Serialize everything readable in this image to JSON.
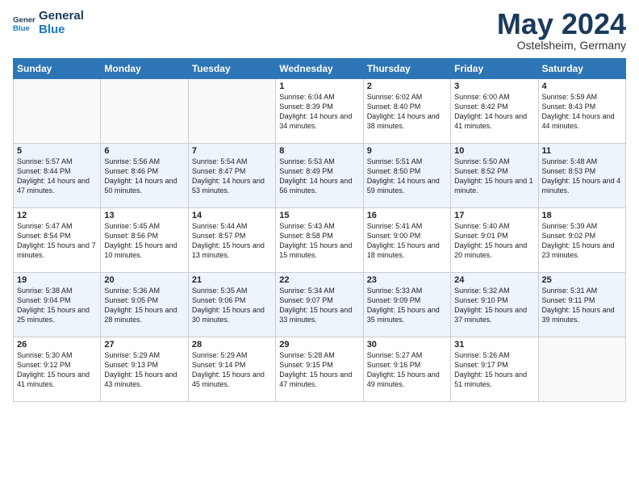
{
  "header": {
    "logo_general": "General",
    "logo_blue": "Blue",
    "month": "May 2024",
    "location": "Ostelsheim, Germany"
  },
  "weekdays": [
    "Sunday",
    "Monday",
    "Tuesday",
    "Wednesday",
    "Thursday",
    "Friday",
    "Saturday"
  ],
  "weeks": [
    [
      {
        "day": "",
        "sunrise": "",
        "sunset": "",
        "daylight": ""
      },
      {
        "day": "",
        "sunrise": "",
        "sunset": "",
        "daylight": ""
      },
      {
        "day": "",
        "sunrise": "",
        "sunset": "",
        "daylight": ""
      },
      {
        "day": "1",
        "sunrise": "Sunrise: 6:04 AM",
        "sunset": "Sunset: 8:39 PM",
        "daylight": "Daylight: 14 hours and 34 minutes."
      },
      {
        "day": "2",
        "sunrise": "Sunrise: 6:02 AM",
        "sunset": "Sunset: 8:40 PM",
        "daylight": "Daylight: 14 hours and 38 minutes."
      },
      {
        "day": "3",
        "sunrise": "Sunrise: 6:00 AM",
        "sunset": "Sunset: 8:42 PM",
        "daylight": "Daylight: 14 hours and 41 minutes."
      },
      {
        "day": "4",
        "sunrise": "Sunrise: 5:59 AM",
        "sunset": "Sunset: 8:43 PM",
        "daylight": "Daylight: 14 hours and 44 minutes."
      }
    ],
    [
      {
        "day": "5",
        "sunrise": "Sunrise: 5:57 AM",
        "sunset": "Sunset: 8:44 PM",
        "daylight": "Daylight: 14 hours and 47 minutes."
      },
      {
        "day": "6",
        "sunrise": "Sunrise: 5:56 AM",
        "sunset": "Sunset: 8:46 PM",
        "daylight": "Daylight: 14 hours and 50 minutes."
      },
      {
        "day": "7",
        "sunrise": "Sunrise: 5:54 AM",
        "sunset": "Sunset: 8:47 PM",
        "daylight": "Daylight: 14 hours and 53 minutes."
      },
      {
        "day": "8",
        "sunrise": "Sunrise: 5:53 AM",
        "sunset": "Sunset: 8:49 PM",
        "daylight": "Daylight: 14 hours and 56 minutes."
      },
      {
        "day": "9",
        "sunrise": "Sunrise: 5:51 AM",
        "sunset": "Sunset: 8:50 PM",
        "daylight": "Daylight: 14 hours and 59 minutes."
      },
      {
        "day": "10",
        "sunrise": "Sunrise: 5:50 AM",
        "sunset": "Sunset: 8:52 PM",
        "daylight": "Daylight: 15 hours and 1 minute."
      },
      {
        "day": "11",
        "sunrise": "Sunrise: 5:48 AM",
        "sunset": "Sunset: 8:53 PM",
        "daylight": "Daylight: 15 hours and 4 minutes."
      }
    ],
    [
      {
        "day": "12",
        "sunrise": "Sunrise: 5:47 AM",
        "sunset": "Sunset: 8:54 PM",
        "daylight": "Daylight: 15 hours and 7 minutes."
      },
      {
        "day": "13",
        "sunrise": "Sunrise: 5:45 AM",
        "sunset": "Sunset: 8:56 PM",
        "daylight": "Daylight: 15 hours and 10 minutes."
      },
      {
        "day": "14",
        "sunrise": "Sunrise: 5:44 AM",
        "sunset": "Sunset: 8:57 PM",
        "daylight": "Daylight: 15 hours and 13 minutes."
      },
      {
        "day": "15",
        "sunrise": "Sunrise: 5:43 AM",
        "sunset": "Sunset: 8:58 PM",
        "daylight": "Daylight: 15 hours and 15 minutes."
      },
      {
        "day": "16",
        "sunrise": "Sunrise: 5:41 AM",
        "sunset": "Sunset: 9:00 PM",
        "daylight": "Daylight: 15 hours and 18 minutes."
      },
      {
        "day": "17",
        "sunrise": "Sunrise: 5:40 AM",
        "sunset": "Sunset: 9:01 PM",
        "daylight": "Daylight: 15 hours and 20 minutes."
      },
      {
        "day": "18",
        "sunrise": "Sunrise: 5:39 AM",
        "sunset": "Sunset: 9:02 PM",
        "daylight": "Daylight: 15 hours and 23 minutes."
      }
    ],
    [
      {
        "day": "19",
        "sunrise": "Sunrise: 5:38 AM",
        "sunset": "Sunset: 9:04 PM",
        "daylight": "Daylight: 15 hours and 25 minutes."
      },
      {
        "day": "20",
        "sunrise": "Sunrise: 5:36 AM",
        "sunset": "Sunset: 9:05 PM",
        "daylight": "Daylight: 15 hours and 28 minutes."
      },
      {
        "day": "21",
        "sunrise": "Sunrise: 5:35 AM",
        "sunset": "Sunset: 9:06 PM",
        "daylight": "Daylight: 15 hours and 30 minutes."
      },
      {
        "day": "22",
        "sunrise": "Sunrise: 5:34 AM",
        "sunset": "Sunset: 9:07 PM",
        "daylight": "Daylight: 15 hours and 33 minutes."
      },
      {
        "day": "23",
        "sunrise": "Sunrise: 5:33 AM",
        "sunset": "Sunset: 9:09 PM",
        "daylight": "Daylight: 15 hours and 35 minutes."
      },
      {
        "day": "24",
        "sunrise": "Sunrise: 5:32 AM",
        "sunset": "Sunset: 9:10 PM",
        "daylight": "Daylight: 15 hours and 37 minutes."
      },
      {
        "day": "25",
        "sunrise": "Sunrise: 5:31 AM",
        "sunset": "Sunset: 9:11 PM",
        "daylight": "Daylight: 15 hours and 39 minutes."
      }
    ],
    [
      {
        "day": "26",
        "sunrise": "Sunrise: 5:30 AM",
        "sunset": "Sunset: 9:12 PM",
        "daylight": "Daylight: 15 hours and 41 minutes."
      },
      {
        "day": "27",
        "sunrise": "Sunrise: 5:29 AM",
        "sunset": "Sunset: 9:13 PM",
        "daylight": "Daylight: 15 hours and 43 minutes."
      },
      {
        "day": "28",
        "sunrise": "Sunrise: 5:29 AM",
        "sunset": "Sunset: 9:14 PM",
        "daylight": "Daylight: 15 hours and 45 minutes."
      },
      {
        "day": "29",
        "sunrise": "Sunrise: 5:28 AM",
        "sunset": "Sunset: 9:15 PM",
        "daylight": "Daylight: 15 hours and 47 minutes."
      },
      {
        "day": "30",
        "sunrise": "Sunrise: 5:27 AM",
        "sunset": "Sunset: 9:16 PM",
        "daylight": "Daylight: 15 hours and 49 minutes."
      },
      {
        "day": "31",
        "sunrise": "Sunrise: 5:26 AM",
        "sunset": "Sunset: 9:17 PM",
        "daylight": "Daylight: 15 hours and 51 minutes."
      },
      {
        "day": "",
        "sunrise": "",
        "sunset": "",
        "daylight": ""
      }
    ]
  ]
}
